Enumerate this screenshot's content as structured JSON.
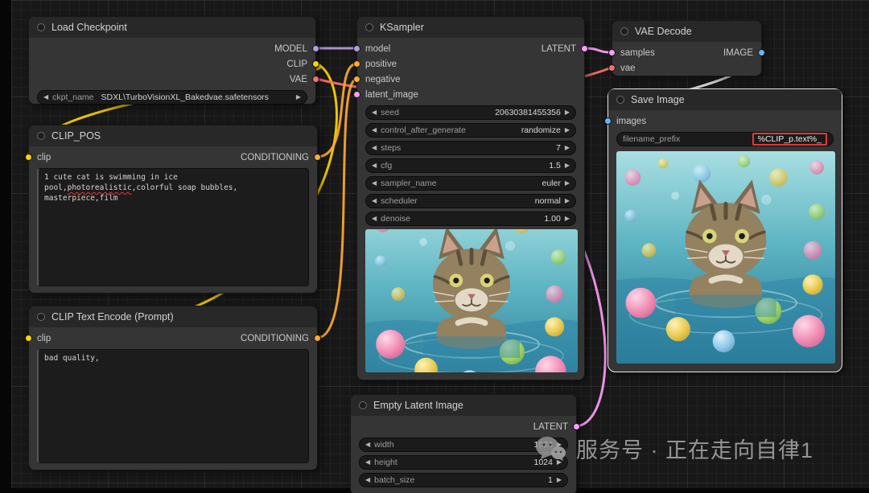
{
  "icons": {
    "decrement": "◀",
    "increment": "▶"
  },
  "colors": {
    "model": "#b39ddb",
    "clip": "#ffd500",
    "vae": "#ff6e6e",
    "conditioning": "#ffa931",
    "latent": "#ff9cf9",
    "image": "#64b5f6",
    "highlight_box": "#e53935",
    "selection_border": "#ffffff"
  },
  "watermark": {
    "text": "服务号 · 正在走向自律1",
    "logo": "wechat-bubbles-logo"
  },
  "nodes": {
    "load_checkpoint": {
      "title": "Load Checkpoint",
      "outputs": [
        "MODEL",
        "CLIP",
        "VAE"
      ],
      "widget": {
        "name": "ckpt_name",
        "value": "SDXL\\TurboVisionXL_Bakedvae.safetensors"
      }
    },
    "clip_pos": {
      "title": "CLIP_POS",
      "input": "clip",
      "output": "CONDITIONING",
      "prompt": {
        "pre": "1 cute cat is swimming in ice pool,",
        "misspelled": "photorealistic",
        "post": ",colorful soap bubbles, masterpiece,film"
      }
    },
    "clip_neg": {
      "title": "CLIP Text Encode (Prompt)",
      "input": "clip",
      "output": "CONDITIONING",
      "prompt": "bad quality,"
    },
    "ksampler": {
      "title": "KSampler",
      "inputs": [
        "model",
        "positive",
        "negative",
        "latent_image"
      ],
      "output": "LATENT",
      "widgets": [
        {
          "name": "seed",
          "value": "20630381455356"
        },
        {
          "name": "control_after_generate",
          "value": "randomize"
        },
        {
          "name": "steps",
          "value": "7"
        },
        {
          "name": "cfg",
          "value": "1.5"
        },
        {
          "name": "sampler_name",
          "value": "euler"
        },
        {
          "name": "scheduler",
          "value": "normal"
        },
        {
          "name": "denoise",
          "value": "1.00"
        }
      ],
      "preview": "cat-swimming-in-pool-with-colorful-soap-bubbles"
    },
    "empty_latent": {
      "title": "Empty Latent Image",
      "output": "LATENT",
      "widgets": [
        {
          "name": "width",
          "value": "1024"
        },
        {
          "name": "height",
          "value": "1024"
        },
        {
          "name": "batch_size",
          "value": "1"
        }
      ]
    },
    "vae_decode": {
      "title": "VAE Decode",
      "inputs": [
        "samples",
        "vae"
      ],
      "output": "IMAGE"
    },
    "save_image": {
      "title": "Save Image",
      "input": "images",
      "widget": {
        "name": "filename_prefix",
        "value": "%CLIP_p.text%_"
      },
      "preview": "cat-swimming-in-pool-with-colorful-soap-bubbles"
    }
  }
}
